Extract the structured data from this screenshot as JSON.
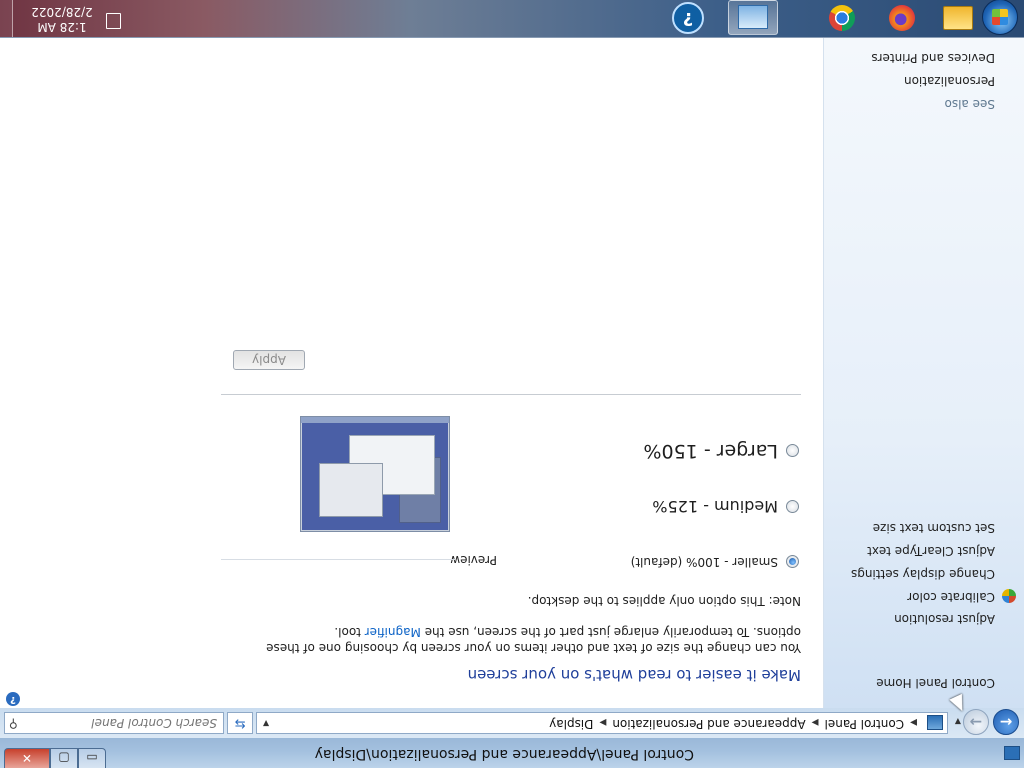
{
  "window": {
    "title": "Control Panel\\Appearance and Personalization\\Display",
    "controls": {
      "minimize": "▭",
      "maximize": "▢",
      "close": "✕"
    }
  },
  "addressbar": {
    "breadcrumbs": [
      "Control Panel",
      "Appearance and Personalization",
      "Display"
    ],
    "search_placeholder": "Search Control Panel"
  },
  "sidebar": {
    "items": [
      {
        "label": "Control Panel Home"
      },
      {
        "label": "Adjust resolution"
      },
      {
        "label": "Calibrate color",
        "icon": "shield-icon"
      },
      {
        "label": "Change display settings"
      },
      {
        "label": "Adjust ClearType text"
      },
      {
        "label": "Set custom text size"
      }
    ],
    "see_also_label": "See also",
    "see_also": [
      {
        "label": "Personalization"
      },
      {
        "label": "Devices and Printers"
      }
    ]
  },
  "main": {
    "heading": "Make it easier to read what's on your screen",
    "description_before": "You can change the size of text and other items on your screen by choosing one of these options. To temporarily enlarge just part of the screen, use the ",
    "description_link": "Magnifier",
    "description_after": " tool.",
    "note": "Note: This option only applies to the desktop.",
    "options": [
      {
        "label": "Smaller - 100% (default)",
        "selected": true
      },
      {
        "label": "Medium - 125%",
        "selected": false
      },
      {
        "label": "Larger - 150%",
        "selected": false
      }
    ],
    "preview_label": "Preview",
    "apply_label": "Apply"
  },
  "taskbar": {
    "apps": [
      {
        "name": "Windows Explorer",
        "icon": "folder-icon"
      },
      {
        "name": "Firefox",
        "icon": "firefox-icon"
      },
      {
        "name": "Chrome",
        "icon": "chrome-icon"
      },
      {
        "name": "Control Panel",
        "icon": "control-panel-icon",
        "active": true
      },
      {
        "name": "Help",
        "icon": "help-icon"
      }
    ],
    "clock": {
      "time": "1:28 AM",
      "date": "2/28/2022"
    }
  },
  "colors": {
    "heading": "#1f3f9a",
    "link": "#0b62c6",
    "sidebar_bg": "#dce8f5"
  }
}
